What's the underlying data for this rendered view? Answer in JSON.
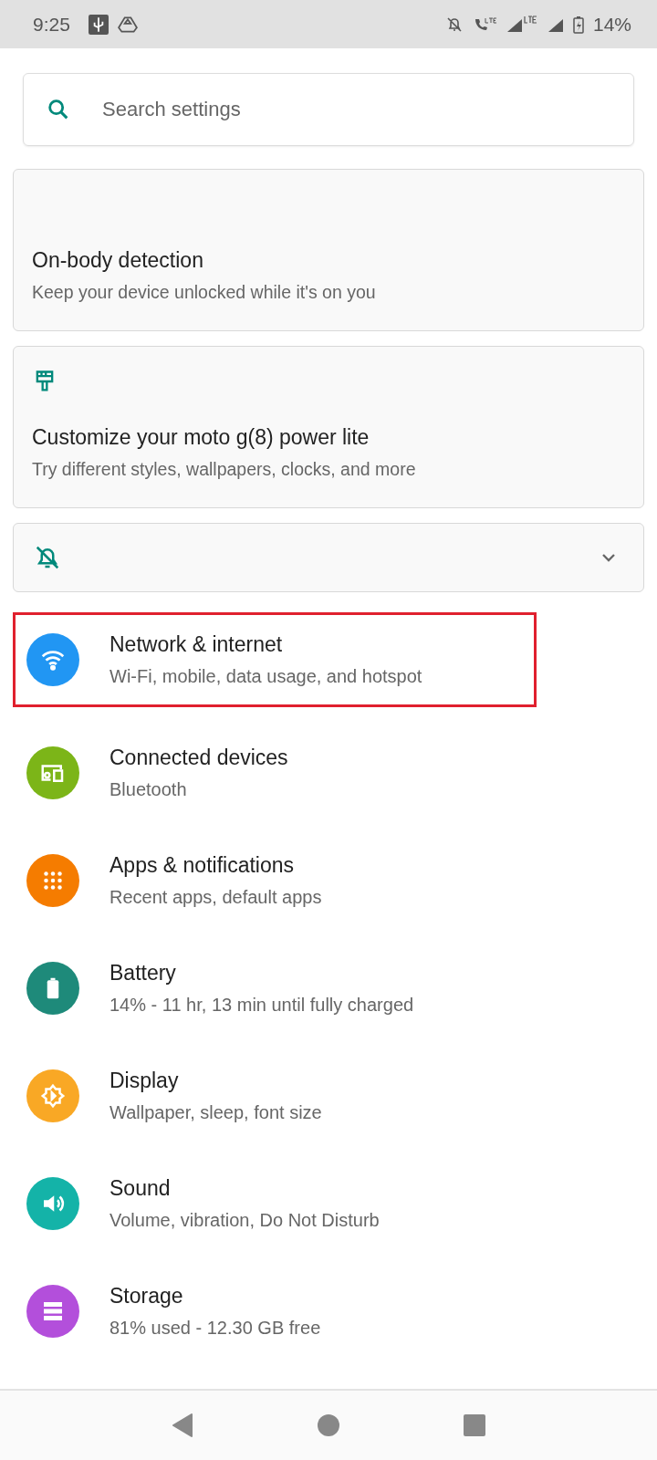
{
  "status_bar": {
    "time": "9:25",
    "battery": "14%"
  },
  "search": {
    "placeholder": "Search settings"
  },
  "suggestions": [
    {
      "kind": "card",
      "title": "On-body detection",
      "subtitle": "Keep your device unlocked while it's on you"
    },
    {
      "kind": "card",
      "title": "Customize your moto g(8) power lite",
      "subtitle": "Try different styles, wallpapers, clocks, and more"
    },
    {
      "kind": "collapsed"
    }
  ],
  "settings": [
    {
      "color": "#2196f3",
      "title": "Network & internet",
      "subtitle": "Wi-Fi, mobile, data usage, and hotspot",
      "highlighted": true
    },
    {
      "color": "#7cb518",
      "title": "Connected devices",
      "subtitle": "Bluetooth",
      "highlighted": false
    },
    {
      "color": "#f57c00",
      "title": "Apps & notifications",
      "subtitle": "Recent apps, default apps",
      "highlighted": false
    },
    {
      "color": "#1e8a7a",
      "title": "Battery",
      "subtitle": "14% - 11 hr, 13 min until fully charged",
      "highlighted": false
    },
    {
      "color": "#f9a825",
      "title": "Display",
      "subtitle": "Wallpaper, sleep, font size",
      "highlighted": false
    },
    {
      "color": "#14b3a8",
      "title": "Sound",
      "subtitle": "Volume, vibration, Do Not Disturb",
      "highlighted": false
    },
    {
      "color": "#b34fdb",
      "title": "Storage",
      "subtitle": "81% used - 12.30 GB free",
      "highlighted": false
    }
  ]
}
